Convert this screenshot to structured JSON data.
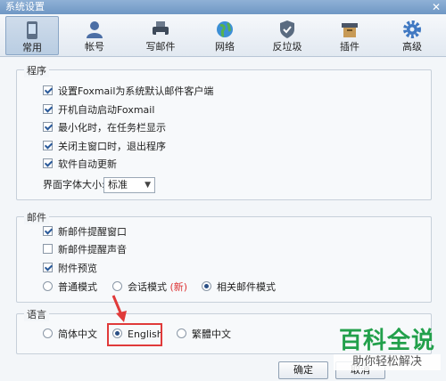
{
  "window": {
    "title": "系统设置",
    "close_glyph": "✕"
  },
  "toolbar": {
    "items": [
      {
        "label": "常用",
        "icon": "phone-icon",
        "active": true
      },
      {
        "label": "帐号",
        "icon": "user-icon"
      },
      {
        "label": "写邮件",
        "icon": "printer-icon"
      },
      {
        "label": "网络",
        "icon": "globe-icon"
      },
      {
        "label": "反垃圾",
        "icon": "shield-icon"
      },
      {
        "label": "插件",
        "icon": "box-icon"
      },
      {
        "label": "高级",
        "icon": "gear-icon"
      }
    ]
  },
  "program": {
    "legend": "程序",
    "options": [
      {
        "label": "设置Foxmail为系统默认邮件客户端",
        "checked": true
      },
      {
        "label": "开机自动启动Foxmail",
        "checked": true
      },
      {
        "label": "最小化时，在任务栏显示",
        "checked": true
      },
      {
        "label": "关闭主窗口时，退出程序",
        "checked": true
      },
      {
        "label": "软件自动更新",
        "checked": true
      }
    ],
    "font_size_label": "界面字体大小:",
    "font_size_value": "标准"
  },
  "mail": {
    "legend": "邮件",
    "options": [
      {
        "label": "新邮件提醒窗口",
        "checked": true
      },
      {
        "label": "新邮件提醒声音",
        "checked": false
      },
      {
        "label": "附件预览",
        "checked": true
      }
    ],
    "modes": [
      {
        "label": "普通模式",
        "selected": false
      },
      {
        "label": "会话模式",
        "note": "(新)",
        "selected": false
      },
      {
        "label": "相关邮件模式",
        "selected": true
      }
    ]
  },
  "language": {
    "legend": "语言",
    "options": [
      {
        "label": "简体中文",
        "selected": false
      },
      {
        "label": "English",
        "selected": true
      },
      {
        "label": "繁體中文",
        "selected": false
      }
    ]
  },
  "footer": {
    "ok_label": "确定",
    "cancel_label": "取消"
  },
  "watermark": {
    "brand": "百科全说",
    "slogan": "助你轻松解决"
  },
  "colors": {
    "highlight": "#e03a3a",
    "watermark_green": "#22a04b"
  }
}
